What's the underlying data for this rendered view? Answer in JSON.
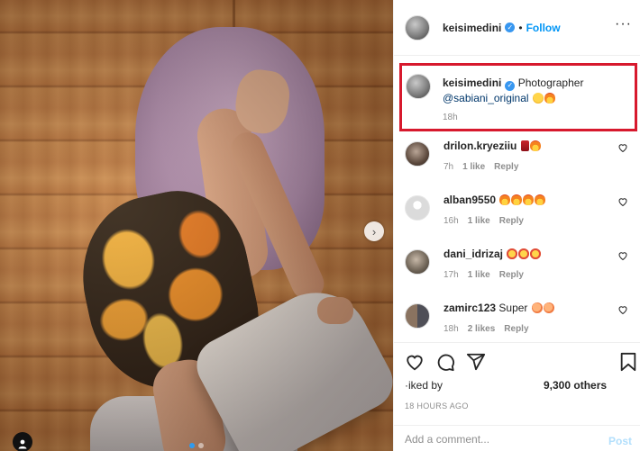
{
  "post": {
    "username": "keisimedini",
    "follow_label": "Follow",
    "separator": "•",
    "more_glyph": "···",
    "nav_arrow": "›"
  },
  "caption": {
    "username": "keisimedini",
    "text": "Photographer",
    "mention": "@sabiani_original",
    "emojis": [
      "laughing-face-emoji",
      "fire-emoji"
    ],
    "time": "18h"
  },
  "comments": [
    {
      "username": "drilon.kryeziiu",
      "emojis": [
        "soda-cup-emoji",
        "fire-emoji"
      ],
      "time": "7h",
      "likes": "1 like",
      "reply": "Reply"
    },
    {
      "username": "alban9550",
      "emojis": [
        "fire-emoji",
        "fire-emoji",
        "fire-emoji",
        "fire-emoji"
      ],
      "time": "16h",
      "likes": "1 like",
      "reply": "Reply"
    },
    {
      "username": "dani_idrizaj",
      "emojis": [
        "star-struck-emoji",
        "star-struck-emoji",
        "star-struck-emoji"
      ],
      "time": "17h",
      "likes": "1 like",
      "reply": "Reply"
    },
    {
      "username": "zamirc123",
      "text": "Super",
      "emojis": [
        "peach-emoji",
        "peach-emoji"
      ],
      "time": "18h",
      "likes": "2 likes",
      "reply": "Reply"
    }
  ],
  "likes": {
    "liked_by": "·iked by",
    "others": "9,300 others"
  },
  "timestamp": "18 HOURS AGO",
  "comment_input": {
    "placeholder": "Add a comment...",
    "post_label": "Post"
  },
  "colors": {
    "accent_blue": "#0095f6",
    "highlight_red": "#d7192d",
    "muted_text": "#8e8e8e",
    "verified_blue": "#3897f0"
  },
  "icons": [
    "heart-icon",
    "comment-icon",
    "share-icon",
    "bookmark-icon",
    "more-options-icon",
    "verified-badge-icon",
    "tag-user-icon",
    "next-arrow-icon"
  ],
  "carousel": {
    "total": 2,
    "active": 1
  }
}
